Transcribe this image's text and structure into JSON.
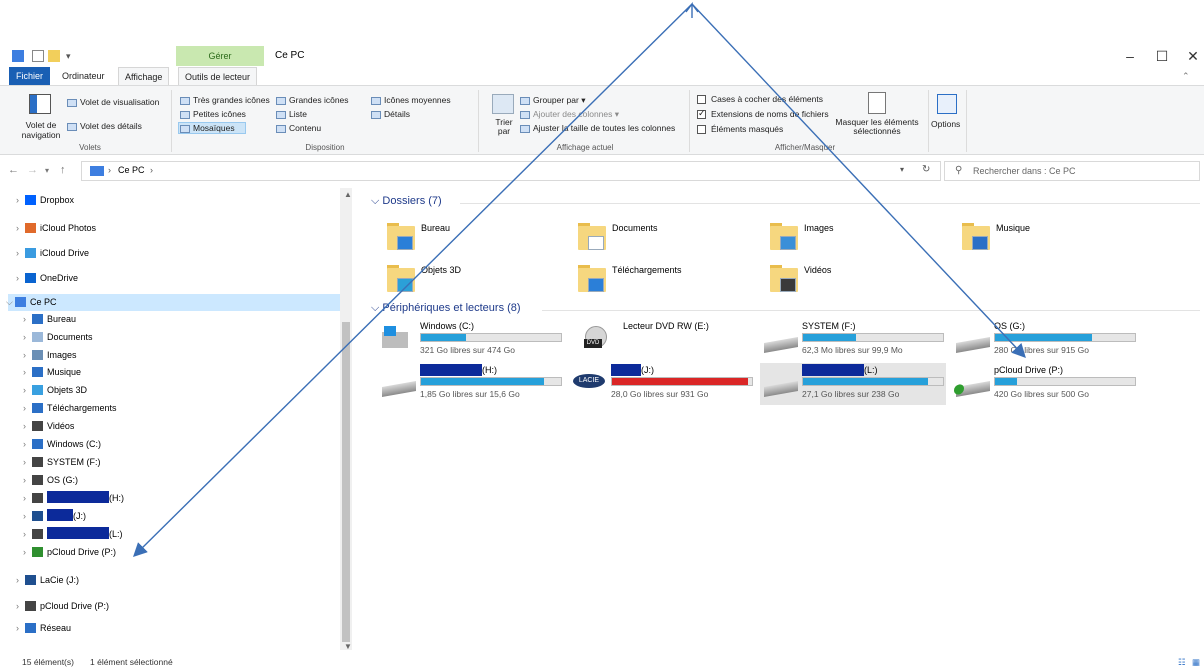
{
  "window": {
    "title": "Ce PC",
    "manage_tab": "Gérer",
    "ribbon_tabs": [
      "Fichier",
      "Ordinateur",
      "Affichage",
      "Outils de lecteur"
    ]
  },
  "ribbon": {
    "volets": {
      "nav_pane": "Volet de navigation",
      "preview_pane": "Volet de visualisation",
      "details_pane": "Volet des détails",
      "group": "Volets"
    },
    "disposition": {
      "items": [
        "Très grandes icônes",
        "Grandes icônes",
        "Icônes moyennes",
        "Petites icônes",
        "Liste",
        "Détails",
        "Mosaïques",
        "Contenu"
      ],
      "group": "Disposition"
    },
    "affichage_actuel": {
      "sort": "Trier par",
      "group_by": "Grouper par",
      "add_columns": "Ajouter des colonnes",
      "fit_columns": "Ajuster la taille de toutes les colonnes",
      "group": "Affichage actuel"
    },
    "afficher_masquer": {
      "item_checkboxes": "Cases à cocher des éléments",
      "extensions": "Extensions de noms de fichiers",
      "hidden_items": "Éléments masqués",
      "hide_selected": "Masquer les éléments sélectionnés",
      "group": "Afficher/Masquer"
    },
    "options": "Options"
  },
  "address": {
    "path": "Ce PC",
    "search_placeholder": "Rechercher dans : Ce PC"
  },
  "nav_pane": {
    "items": [
      {
        "label": "Dropbox"
      },
      {
        "label": "iCloud Photos"
      },
      {
        "label": "iCloud Drive"
      },
      {
        "label": "OneDrive"
      },
      {
        "label": "Ce PC"
      },
      {
        "label": "Bureau"
      },
      {
        "label": "Documents"
      },
      {
        "label": "Images"
      },
      {
        "label": "Musique"
      },
      {
        "label": "Objets 3D"
      },
      {
        "label": "Téléchargements"
      },
      {
        "label": "Vidéos"
      },
      {
        "label": "Windows (C:)"
      },
      {
        "label": "SYSTEM (F:)"
      },
      {
        "label": "OS (G:)"
      },
      {
        "label": "(H:)"
      },
      {
        "label": "(J:)"
      },
      {
        "label": "(L:)"
      },
      {
        "label": "pCloud Drive (P:)"
      },
      {
        "label": "LaCie (J:)"
      },
      {
        "label": "pCloud Drive (P:)"
      },
      {
        "label": "Réseau"
      }
    ]
  },
  "content": {
    "folders_header": "Dossiers (7)",
    "folders": [
      "Bureau",
      "Documents",
      "Images",
      "Musique",
      "Objets 3D",
      "Téléchargements",
      "Vidéos"
    ],
    "drives_header": "Périphériques et lecteurs (8)",
    "drives": [
      {
        "label": "Windows (C:)",
        "free": "321 Go libres sur 474 Go",
        "used": 0.32
      },
      {
        "label": "Lecteur DVD RW (E:)"
      },
      {
        "label": "SYSTEM (F:)",
        "free": "62,3 Mo libres sur 99,9 Mo",
        "used": 0.38
      },
      {
        "label": "OS (G:)",
        "free": "280 Go libres sur 915 Go",
        "used": 0.69
      },
      {
        "label": "(H:)",
        "free": "1,85 Go libres sur 15,6 Go",
        "used": 0.88
      },
      {
        "label": "(J:)",
        "free": "28,0 Go libres sur 931 Go",
        "used": 0.97
      },
      {
        "label": "(L:)",
        "free": "27,1 Go libres sur 238 Go",
        "used": 0.89
      },
      {
        "label": "pCloud Drive (P:)",
        "free": "420 Go libres sur 500 Go",
        "used": 0.16
      }
    ]
  },
  "status": {
    "count": "15 élément(s)",
    "selected": "1 élément sélectionné"
  },
  "colors": {
    "accent": "#1a5fb4",
    "bar": "#26a0da",
    "bar_full": "#da2626",
    "redaction": "#0c2a9a",
    "arrow": "#3b6fb6"
  }
}
